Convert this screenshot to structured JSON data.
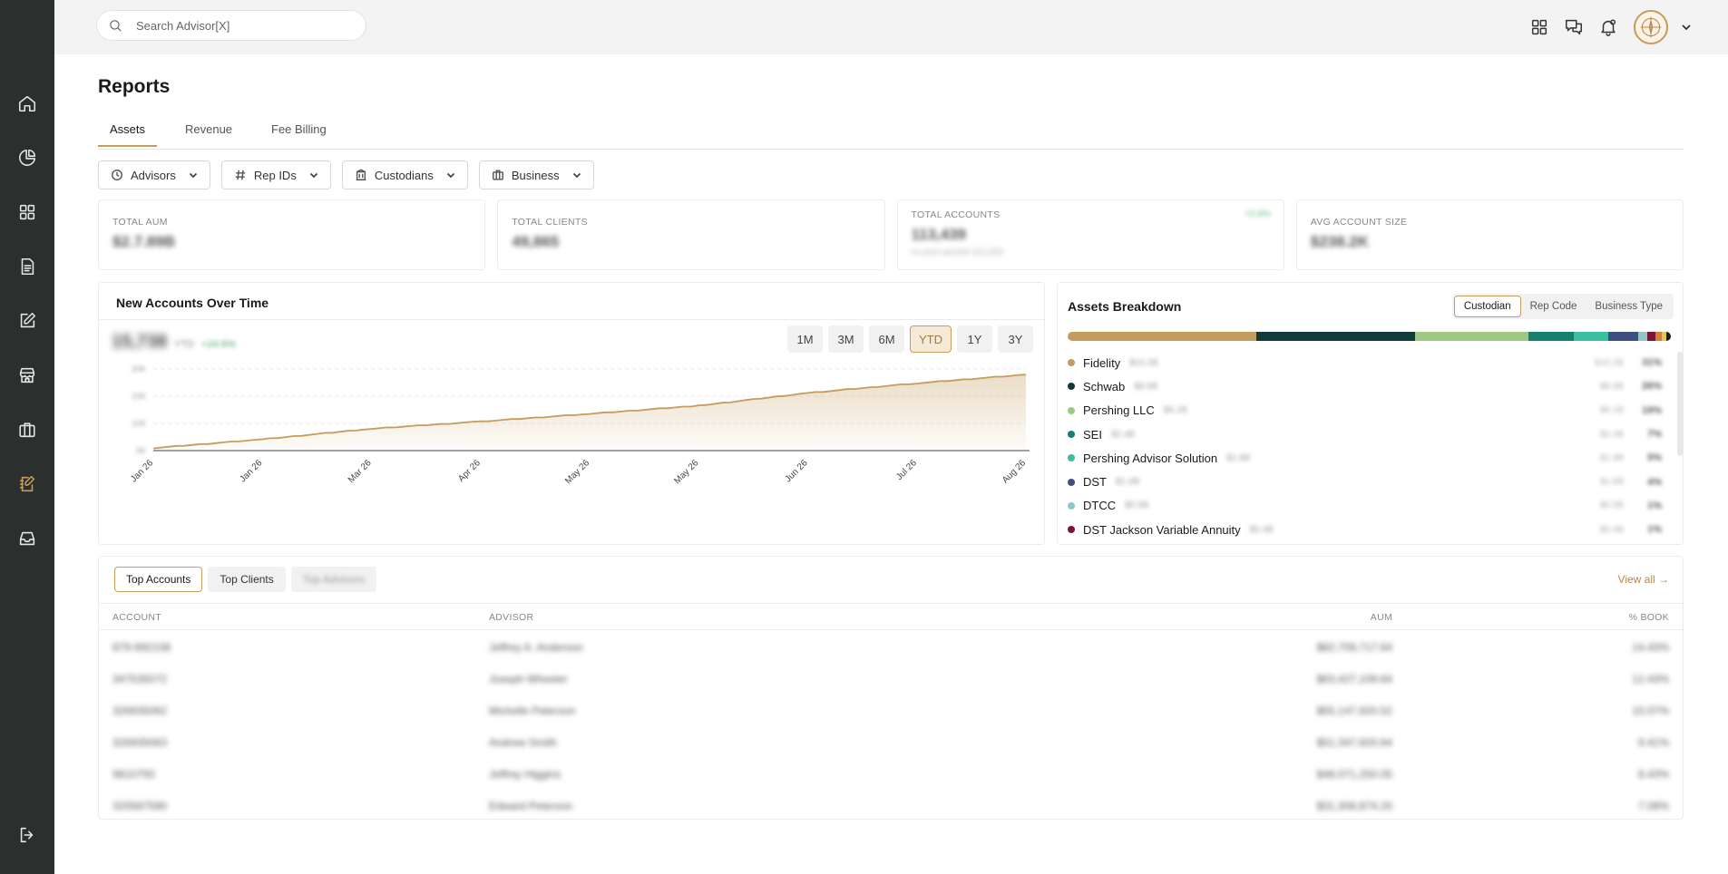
{
  "search": {
    "placeholder": "Search Advisor[X]"
  },
  "page": {
    "title": "Reports"
  },
  "tabs": [
    {
      "label": "Assets",
      "active": true
    },
    {
      "label": "Revenue"
    },
    {
      "label": "Fee Billing"
    }
  ],
  "filters": [
    {
      "label": "Advisors",
      "icon": "clock-icon"
    },
    {
      "label": "Rep IDs",
      "icon": "hash-icon"
    },
    {
      "label": "Custodians",
      "icon": "bank-icon"
    },
    {
      "label": "Business",
      "icon": "briefcase-icon"
    }
  ],
  "kpis": [
    {
      "label": "TOTAL AUM",
      "value": "$2.7.89B"
    },
    {
      "label": "TOTAL CLIENTS",
      "value": "49,865"
    },
    {
      "label": "TOTAL ACCOUNTS",
      "value": "113,439",
      "badge": "+2.8%",
      "sub": "vs prior period 110,323"
    },
    {
      "label": "AVG ACCOUNT SIZE",
      "value": "$238.2K"
    }
  ],
  "chart": {
    "title": "New Accounts Over Time",
    "headline": "15,738",
    "headline_sub": "YTD",
    "headline_change": "+24.6%",
    "ranges": [
      {
        "label": "1M"
      },
      {
        "label": "3M"
      },
      {
        "label": "6M"
      },
      {
        "label": "YTD",
        "active": true
      },
      {
        "label": "1Y"
      },
      {
        "label": "3Y"
      }
    ]
  },
  "chart_data": {
    "type": "area",
    "title": "New Accounts Over Time",
    "x": [
      "Jan 26",
      "Jan 26",
      "Mar 26",
      "Apr 26",
      "May 26",
      "May 26",
      "Jun 26",
      "Jul 26",
      "Aug 26"
    ],
    "series": [
      {
        "values": [
          500,
          2200,
          4300,
          5700,
          7200,
          8800,
          11300,
          13200,
          14900
        ]
      }
    ],
    "ylim": [
      0,
      16000
    ],
    "yticks": [
      "20K",
      "15K",
      "10K",
      "5K"
    ],
    "grid": true,
    "color": "#c69c5d"
  },
  "breakdown": {
    "title": "Assets Breakdown",
    "toggles": [
      {
        "label": "Custodian",
        "active": true
      },
      {
        "label": "Rep Code"
      },
      {
        "label": "Business Type"
      }
    ],
    "segments": [
      {
        "value": 25,
        "color": "#c69c5d"
      },
      {
        "value": 21,
        "color": "#0f3b3c"
      },
      {
        "value": 15,
        "color": "#9ec985"
      },
      {
        "value": 6,
        "color": "#167f70"
      },
      {
        "value": 4.5,
        "color": "#3bbfa0"
      },
      {
        "value": 4,
        "color": "#3c4f7e"
      },
      {
        "value": 1.2,
        "color": "#8fc7c7"
      },
      {
        "value": 1.1,
        "color": "#7c1530"
      },
      {
        "value": 0.8,
        "color": "#d97b3a"
      },
      {
        "value": 0.6,
        "color": "#e2c65a"
      },
      {
        "value": 0.6,
        "color": "#1b1b1b"
      }
    ],
    "items": [
      {
        "name": "Fidelity",
        "color": "#c69c5d",
        "amount": "$10.2B",
        "r1": "$10.2B",
        "r2": "31%"
      },
      {
        "name": "Schwab",
        "color": "#0f3b3c",
        "amount": "$8.6B",
        "r1": "$8.6B",
        "r2": "26%"
      },
      {
        "name": "Pershing LLC",
        "color": "#9ec985",
        "amount": "$6.1B",
        "r1": "$6.1B",
        "r2": "19%"
      },
      {
        "name": "SEI",
        "color": "#167f70",
        "amount": "$2.4B",
        "r1": "$2.4B",
        "r2": "7%"
      },
      {
        "name": "Pershing Advisor Solution",
        "color": "#3bbfa0",
        "amount": "$1.8B",
        "r1": "$1.8B",
        "r2": "5%"
      },
      {
        "name": "DST",
        "color": "#3c4f7e",
        "amount": "$1.6B",
        "r1": "$1.6B",
        "r2": "4%"
      },
      {
        "name": "DTCC",
        "color": "#8fc7c7",
        "amount": "$0.5B",
        "r1": "$0.5B",
        "r2": "1%"
      },
      {
        "name": "DST Jackson Variable Annuity",
        "color": "#7c1530",
        "amount": "$0.4B",
        "r1": "$0.4B",
        "r2": "1%"
      }
    ]
  },
  "table": {
    "tabs": [
      {
        "label": "Top Accounts",
        "active": true
      },
      {
        "label": "Top Clients"
      },
      {
        "label": "Top Advisors",
        "ghost": true
      }
    ],
    "view_all": "View all →",
    "columns": {
      "account": "ACCOUNT",
      "advisor": "ADVISOR",
      "aum": "AUM",
      "book": "% BOOK"
    },
    "rows": [
      {
        "account": "879-992108",
        "advisor": "Jeffrey A. Anderson",
        "aum": "$82,709,717.64",
        "book": "14.43%"
      },
      {
        "account": "347535072",
        "advisor": "Joseph Wheeler",
        "aum": "$63,427,109.64",
        "book": "12.43%"
      },
      {
        "account": "326935062",
        "advisor": "Michelle Peterson",
        "aum": "$55,147,920.52",
        "book": "10.07%"
      },
      {
        "account": "326935063",
        "advisor": "Andrew Smith",
        "aum": "$51,347,920.64",
        "book": "9.41%"
      },
      {
        "account": "9810750",
        "advisor": "Jeffrey Higgins",
        "aum": "$48,071,250.05",
        "book": "8.43%"
      },
      {
        "account": "320587590",
        "advisor": "Edward Peterson",
        "aum": "$31,308,874.20",
        "book": "7.08%"
      }
    ]
  }
}
